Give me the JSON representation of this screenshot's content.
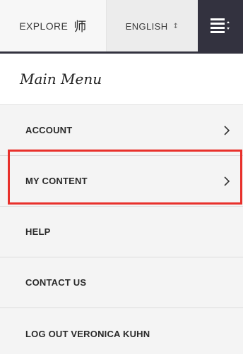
{
  "topbar": {
    "explore_label": "EXPLORE",
    "explore_icon": "explore-icon",
    "language_label": "ENGLISH",
    "menu_icon": "menu-icon"
  },
  "menu": {
    "title": "Main Menu",
    "items": [
      {
        "label": "ACCOUNT",
        "chevron": true
      },
      {
        "label": "MY CONTENT",
        "chevron": true,
        "highlighted": true
      },
      {
        "label": "HELP",
        "chevron": false
      },
      {
        "label": "CONTACT US",
        "chevron": false
      },
      {
        "label": "LOG OUT VERONICA KUHN",
        "chevron": false
      }
    ]
  },
  "colors": {
    "accent_dark": "#33323f",
    "highlight_red": "#e8302b"
  }
}
